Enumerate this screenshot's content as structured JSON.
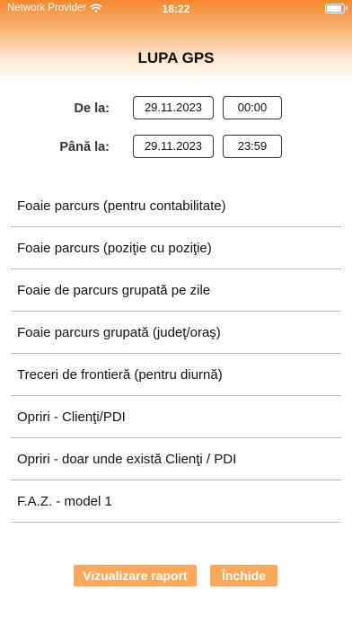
{
  "status_bar": {
    "carrier": "Network Provider",
    "time": "18:22"
  },
  "header": {
    "title": "LUPA GPS"
  },
  "date_range": {
    "from_label": "De la:",
    "from_date": "29.11.2023",
    "from_time": "00:00",
    "to_label": "Până la:",
    "to_date": "29.11.2023",
    "to_time": "23:59"
  },
  "reports": [
    {
      "label": "Foaie parcurs (pentru contabilitate)"
    },
    {
      "label": "Foaie parcurs (poziţie cu poziţie)"
    },
    {
      "label": "Foaie de parcurs grupată pe zile"
    },
    {
      "label": "Foaie parcurs grupată (judeţ/oraş)"
    },
    {
      "label": "Treceri de frontieră (pentru diurnă)"
    },
    {
      "label": "Opriri - Clienţi/PDI"
    },
    {
      "label": "Opriri - doar unde există Clienţi / PDI"
    },
    {
      "label": "F.A.Z. - model 1"
    }
  ],
  "actions": {
    "view_report": "Vizualizare raport",
    "close": "Închide"
  },
  "colors": {
    "accent": "#f9a85c",
    "gradient_top": "#f5882e"
  }
}
